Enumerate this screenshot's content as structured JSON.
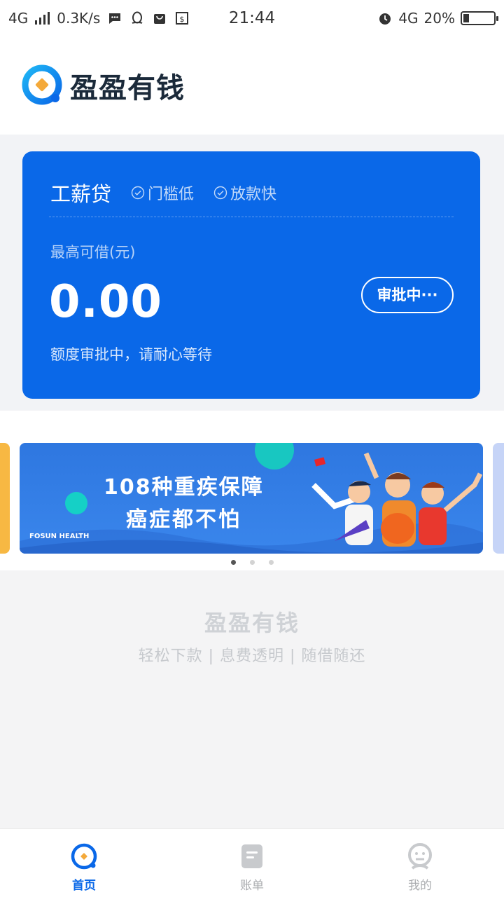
{
  "status_bar": {
    "network_left": "4G",
    "speed": "0.3K/s",
    "time": "21:44",
    "network_right": "4G",
    "battery": "20%",
    "battery_level": 0.2
  },
  "header": {
    "app_name": "盈盈有钱"
  },
  "loan_card": {
    "product_name": "工薪贷",
    "tags": [
      "门槛低",
      "放款快"
    ],
    "limit_label": "最高可借(元)",
    "amount": "0.00",
    "status_button": "审批中···",
    "hint": "额度审批中，请耐心等待",
    "color": "#0a68e8"
  },
  "banner": {
    "line1": "108种重疾保障",
    "line2": "癌症都不怕",
    "brand": "FOSUN HEALTH",
    "active_index": 0,
    "count": 3
  },
  "brand_footer": {
    "name": "盈盈有钱",
    "slogan": "轻松下款 | 息费透明 | 随借随还"
  },
  "tab_bar": {
    "tabs": [
      {
        "label": "首页",
        "icon": "home-icon",
        "active": true
      },
      {
        "label": "账单",
        "icon": "bill-icon",
        "active": false
      },
      {
        "label": "我的",
        "icon": "profile-icon",
        "active": false
      }
    ],
    "active_color": "#0a68e8"
  }
}
